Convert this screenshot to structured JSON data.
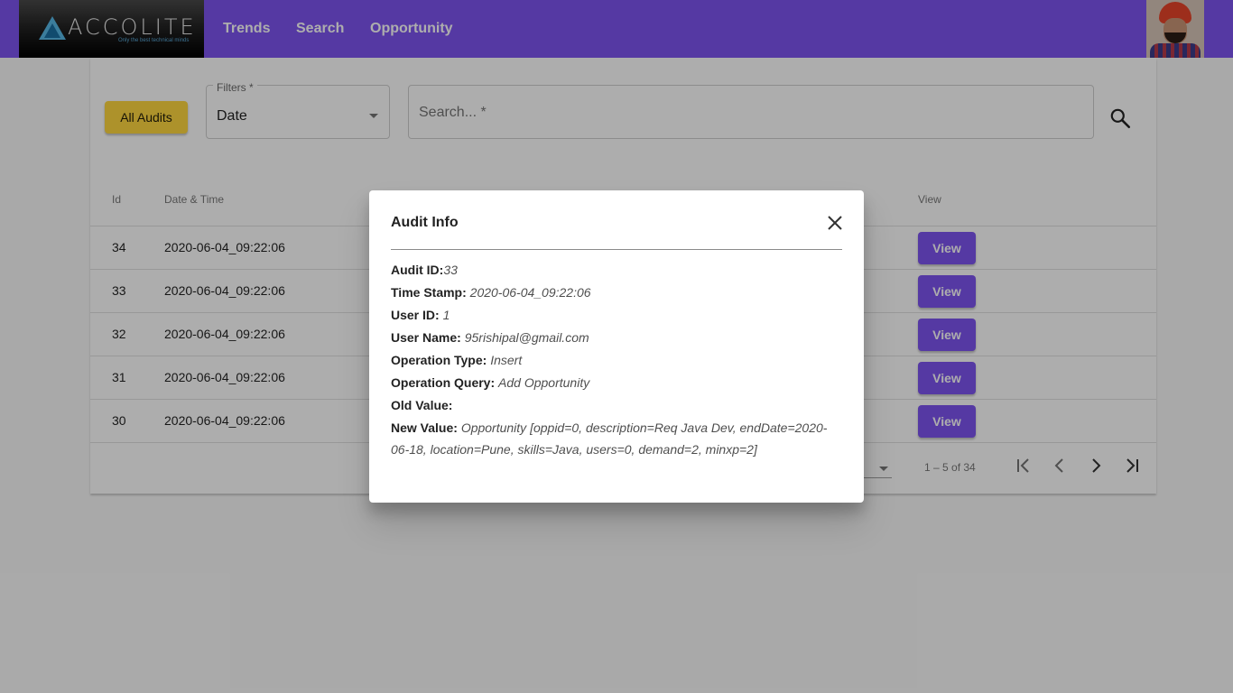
{
  "header": {
    "brand_text": "ACCOLITE",
    "brand_tagline": "Only the best technical minds",
    "nav": [
      "Trends",
      "Search",
      "Opportunity"
    ],
    "colors": {
      "primary": "#7e55f0",
      "accent": "#ffd740"
    }
  },
  "toolbar": {
    "all_audits_label": "All Audits",
    "filter_label": "Filters *",
    "filter_value": "Date",
    "search_placeholder": "Search... *",
    "search_icon": "search-icon"
  },
  "table": {
    "columns": {
      "id": "Id",
      "datetime": "Date & Time",
      "view": "View"
    },
    "rows": [
      {
        "id": "34",
        "datetime": "2020-06-04_09:22:06",
        "action": "View"
      },
      {
        "id": "33",
        "datetime": "2020-06-04_09:22:06",
        "action": "View"
      },
      {
        "id": "32",
        "datetime": "2020-06-04_09:22:06",
        "action": "View"
      },
      {
        "id": "31",
        "datetime": "2020-06-04_09:22:06",
        "action": "View"
      },
      {
        "id": "30",
        "datetime": "2020-06-04_09:22:06",
        "action": "View"
      }
    ],
    "paginator": {
      "range_label": "1 – 5 of 34"
    }
  },
  "dialog": {
    "title": "Audit Info",
    "fields": {
      "audit_id_label": "Audit ID:",
      "audit_id": "33",
      "timestamp_label": "Time Stamp:",
      "timestamp": "2020-06-04_09:22:06",
      "user_id_label": "User ID:",
      "user_id": "1",
      "user_name_label": "User Name:",
      "user_name": "95rishipal@gmail.com",
      "op_type_label": "Operation Type:",
      "op_type": "Insert",
      "op_query_label": "Operation Query:",
      "op_query": "Add Opportunity",
      "old_value_label": "Old Value:",
      "old_value": "",
      "new_value_label": "New Value:",
      "new_value": "Opportunity [oppid=0, description=Req Java Dev, endDate=2020-06-18, location=Pune, skills=Java, users=0, demand=2, minxp=2]"
    }
  }
}
